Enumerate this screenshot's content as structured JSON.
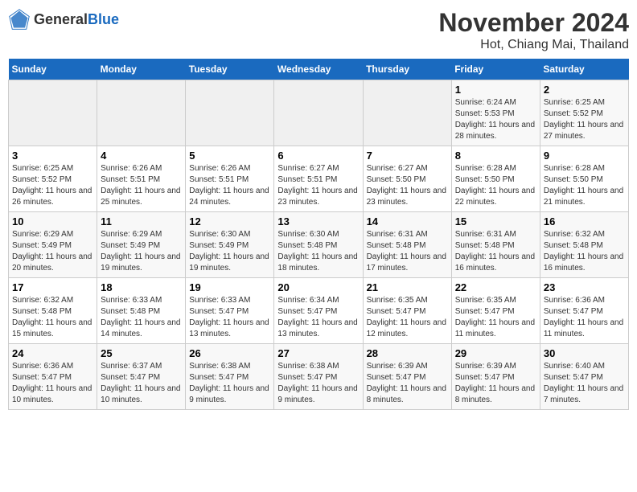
{
  "header": {
    "logo_general": "General",
    "logo_blue": "Blue",
    "main_title": "November 2024",
    "sub_title": "Hot, Chiang Mai, Thailand"
  },
  "weekdays": [
    "Sunday",
    "Monday",
    "Tuesday",
    "Wednesday",
    "Thursday",
    "Friday",
    "Saturday"
  ],
  "weeks": [
    [
      {
        "day": "",
        "sunrise": "",
        "sunset": "",
        "daylight": ""
      },
      {
        "day": "",
        "sunrise": "",
        "sunset": "",
        "daylight": ""
      },
      {
        "day": "",
        "sunrise": "",
        "sunset": "",
        "daylight": ""
      },
      {
        "day": "",
        "sunrise": "",
        "sunset": "",
        "daylight": ""
      },
      {
        "day": "",
        "sunrise": "",
        "sunset": "",
        "daylight": ""
      },
      {
        "day": "1",
        "sunrise": "Sunrise: 6:24 AM",
        "sunset": "Sunset: 5:53 PM",
        "daylight": "Daylight: 11 hours and 28 minutes."
      },
      {
        "day": "2",
        "sunrise": "Sunrise: 6:25 AM",
        "sunset": "Sunset: 5:52 PM",
        "daylight": "Daylight: 11 hours and 27 minutes."
      }
    ],
    [
      {
        "day": "3",
        "sunrise": "Sunrise: 6:25 AM",
        "sunset": "Sunset: 5:52 PM",
        "daylight": "Daylight: 11 hours and 26 minutes."
      },
      {
        "day": "4",
        "sunrise": "Sunrise: 6:26 AM",
        "sunset": "Sunset: 5:51 PM",
        "daylight": "Daylight: 11 hours and 25 minutes."
      },
      {
        "day": "5",
        "sunrise": "Sunrise: 6:26 AM",
        "sunset": "Sunset: 5:51 PM",
        "daylight": "Daylight: 11 hours and 24 minutes."
      },
      {
        "day": "6",
        "sunrise": "Sunrise: 6:27 AM",
        "sunset": "Sunset: 5:51 PM",
        "daylight": "Daylight: 11 hours and 23 minutes."
      },
      {
        "day": "7",
        "sunrise": "Sunrise: 6:27 AM",
        "sunset": "Sunset: 5:50 PM",
        "daylight": "Daylight: 11 hours and 23 minutes."
      },
      {
        "day": "8",
        "sunrise": "Sunrise: 6:28 AM",
        "sunset": "Sunset: 5:50 PM",
        "daylight": "Daylight: 11 hours and 22 minutes."
      },
      {
        "day": "9",
        "sunrise": "Sunrise: 6:28 AM",
        "sunset": "Sunset: 5:50 PM",
        "daylight": "Daylight: 11 hours and 21 minutes."
      }
    ],
    [
      {
        "day": "10",
        "sunrise": "Sunrise: 6:29 AM",
        "sunset": "Sunset: 5:49 PM",
        "daylight": "Daylight: 11 hours and 20 minutes."
      },
      {
        "day": "11",
        "sunrise": "Sunrise: 6:29 AM",
        "sunset": "Sunset: 5:49 PM",
        "daylight": "Daylight: 11 hours and 19 minutes."
      },
      {
        "day": "12",
        "sunrise": "Sunrise: 6:30 AM",
        "sunset": "Sunset: 5:49 PM",
        "daylight": "Daylight: 11 hours and 19 minutes."
      },
      {
        "day": "13",
        "sunrise": "Sunrise: 6:30 AM",
        "sunset": "Sunset: 5:48 PM",
        "daylight": "Daylight: 11 hours and 18 minutes."
      },
      {
        "day": "14",
        "sunrise": "Sunrise: 6:31 AM",
        "sunset": "Sunset: 5:48 PM",
        "daylight": "Daylight: 11 hours and 17 minutes."
      },
      {
        "day": "15",
        "sunrise": "Sunrise: 6:31 AM",
        "sunset": "Sunset: 5:48 PM",
        "daylight": "Daylight: 11 hours and 16 minutes."
      },
      {
        "day": "16",
        "sunrise": "Sunrise: 6:32 AM",
        "sunset": "Sunset: 5:48 PM",
        "daylight": "Daylight: 11 hours and 16 minutes."
      }
    ],
    [
      {
        "day": "17",
        "sunrise": "Sunrise: 6:32 AM",
        "sunset": "Sunset: 5:48 PM",
        "daylight": "Daylight: 11 hours and 15 minutes."
      },
      {
        "day": "18",
        "sunrise": "Sunrise: 6:33 AM",
        "sunset": "Sunset: 5:48 PM",
        "daylight": "Daylight: 11 hours and 14 minutes."
      },
      {
        "day": "19",
        "sunrise": "Sunrise: 6:33 AM",
        "sunset": "Sunset: 5:47 PM",
        "daylight": "Daylight: 11 hours and 13 minutes."
      },
      {
        "day": "20",
        "sunrise": "Sunrise: 6:34 AM",
        "sunset": "Sunset: 5:47 PM",
        "daylight": "Daylight: 11 hours and 13 minutes."
      },
      {
        "day": "21",
        "sunrise": "Sunrise: 6:35 AM",
        "sunset": "Sunset: 5:47 PM",
        "daylight": "Daylight: 11 hours and 12 minutes."
      },
      {
        "day": "22",
        "sunrise": "Sunrise: 6:35 AM",
        "sunset": "Sunset: 5:47 PM",
        "daylight": "Daylight: 11 hours and 11 minutes."
      },
      {
        "day": "23",
        "sunrise": "Sunrise: 6:36 AM",
        "sunset": "Sunset: 5:47 PM",
        "daylight": "Daylight: 11 hours and 11 minutes."
      }
    ],
    [
      {
        "day": "24",
        "sunrise": "Sunrise: 6:36 AM",
        "sunset": "Sunset: 5:47 PM",
        "daylight": "Daylight: 11 hours and 10 minutes."
      },
      {
        "day": "25",
        "sunrise": "Sunrise: 6:37 AM",
        "sunset": "Sunset: 5:47 PM",
        "daylight": "Daylight: 11 hours and 10 minutes."
      },
      {
        "day": "26",
        "sunrise": "Sunrise: 6:38 AM",
        "sunset": "Sunset: 5:47 PM",
        "daylight": "Daylight: 11 hours and 9 minutes."
      },
      {
        "day": "27",
        "sunrise": "Sunrise: 6:38 AM",
        "sunset": "Sunset: 5:47 PM",
        "daylight": "Daylight: 11 hours and 9 minutes."
      },
      {
        "day": "28",
        "sunrise": "Sunrise: 6:39 AM",
        "sunset": "Sunset: 5:47 PM",
        "daylight": "Daylight: 11 hours and 8 minutes."
      },
      {
        "day": "29",
        "sunrise": "Sunrise: 6:39 AM",
        "sunset": "Sunset: 5:47 PM",
        "daylight": "Daylight: 11 hours and 8 minutes."
      },
      {
        "day": "30",
        "sunrise": "Sunrise: 6:40 AM",
        "sunset": "Sunset: 5:47 PM",
        "daylight": "Daylight: 11 hours and 7 minutes."
      }
    ]
  ]
}
